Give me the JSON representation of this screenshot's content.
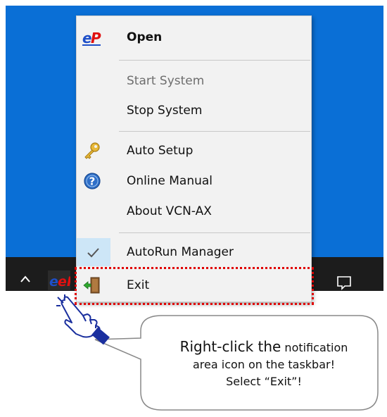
{
  "menu": {
    "items": [
      {
        "label": "Open",
        "icon": "ep-logo-icon",
        "bold": true,
        "disabled": false,
        "checked": false
      },
      {
        "label": "Start System",
        "icon": "",
        "bold": false,
        "disabled": true,
        "checked": false
      },
      {
        "label": "Stop System",
        "icon": "",
        "bold": false,
        "disabled": false,
        "checked": false
      },
      {
        "label": "Auto Setup",
        "icon": "key-icon",
        "bold": false,
        "disabled": false,
        "checked": false
      },
      {
        "label": "Online Manual",
        "icon": "help-icon",
        "bold": false,
        "disabled": false,
        "checked": false
      },
      {
        "label": "About VCN-AX",
        "icon": "",
        "bold": false,
        "disabled": false,
        "checked": false
      },
      {
        "label": "AutoRun Manager",
        "icon": "checkmark-icon",
        "bold": false,
        "disabled": false,
        "checked": true
      },
      {
        "label": "Exit",
        "icon": "exit-door-icon",
        "bold": false,
        "disabled": false,
        "checked": false
      }
    ]
  },
  "tray": {
    "app_icon_text": "eP"
  },
  "callout": {
    "line1_big": "Right-click the",
    "line1_rest": " notification",
    "line2": "area icon on the taskbar!",
    "line3": "Select “Exit”!"
  },
  "colors": {
    "desktop": "#0a6fd6",
    "taskbar": "#1c1c1c",
    "menu_bg": "#f2f2f2",
    "highlight": "#e00000",
    "check_bg": "#cde6f7"
  }
}
